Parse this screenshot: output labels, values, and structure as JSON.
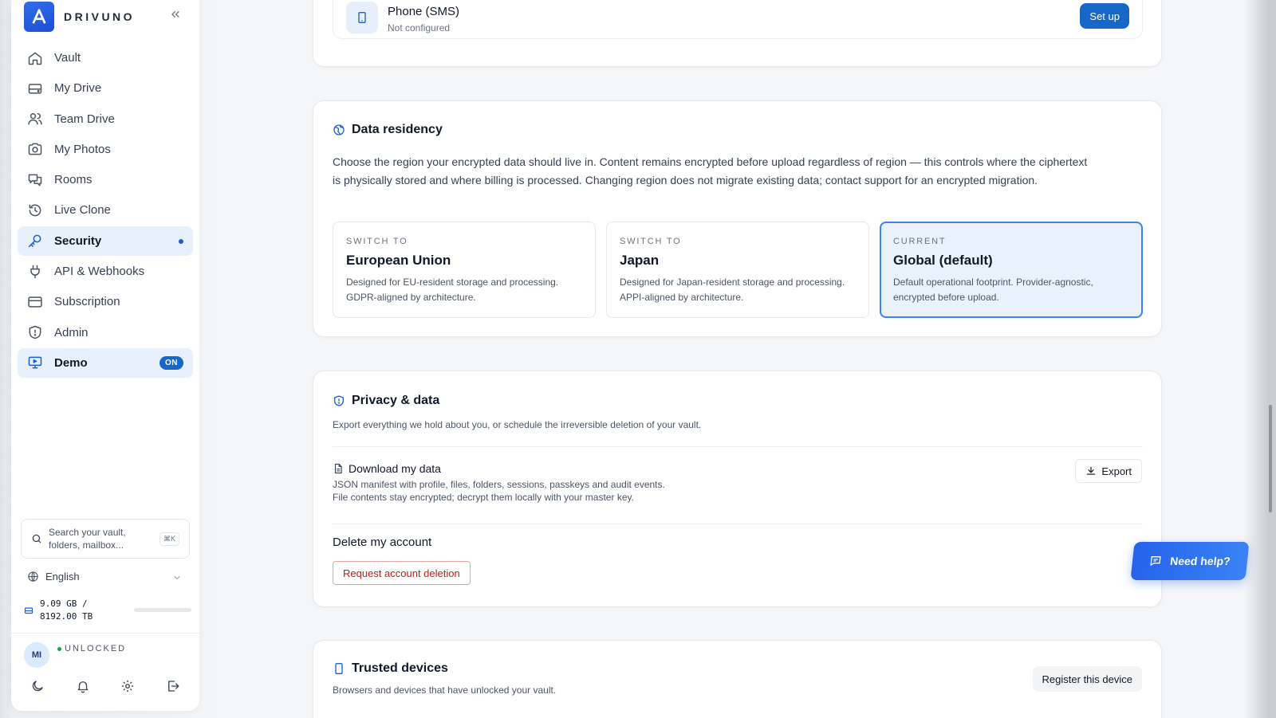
{
  "brand": {
    "name": "DRIVUNO"
  },
  "sidebar": {
    "items": [
      {
        "label": "Vault",
        "icon": "home-icon"
      },
      {
        "label": "My Drive",
        "icon": "drive-icon"
      },
      {
        "label": "Team Drive",
        "icon": "users-icon"
      },
      {
        "label": "My Photos",
        "icon": "camera-icon"
      },
      {
        "label": "Rooms",
        "icon": "chat-icon"
      },
      {
        "label": "Live Clone",
        "icon": "history-icon"
      },
      {
        "label": "Security",
        "icon": "key-icon",
        "active": true
      },
      {
        "label": "API & Webhooks",
        "icon": "plug-icon"
      },
      {
        "label": "Subscription",
        "icon": "card-icon"
      },
      {
        "label": "Admin",
        "icon": "shield-icon"
      },
      {
        "label": "Demo",
        "icon": "monitor-icon",
        "badge": "ON"
      }
    ],
    "search": {
      "placeholder": "Search your vault, folders, mailbox...",
      "shortcut": "⌘K"
    },
    "language": "English",
    "storage": {
      "used": "9.09 GB /",
      "total": "8192.00 TB",
      "fraction": 0.0
    },
    "user": {
      "initials": "MI",
      "status": "UNLOCKED"
    }
  },
  "colors": {
    "accent": "#1767c9",
    "active_bg": "#e8f1fb",
    "danger": "#b42318",
    "current_region_bg": "#e9f2fc"
  },
  "mfa": {
    "phone_title": "Phone (SMS)",
    "phone_status": "Not configured",
    "setup_label": "Set up"
  },
  "residency": {
    "title": "Data residency",
    "description": "Choose the region your encrypted data should live in. Content remains encrypted before upload regardless of region — this controls where the ciphertext is physically stored and where billing is processed. Changing region does not migrate existing data; contact support for an encrypted migration.",
    "regions": [
      {
        "kicker": "SWITCH TO",
        "name": "European Union",
        "desc": "Designed for EU-resident storage and processing. GDPR-aligned by architecture."
      },
      {
        "kicker": "SWITCH TO",
        "name": "Japan",
        "desc": "Designed for Japan-resident storage and processing. APPI-aligned by architecture."
      },
      {
        "kicker": "CURRENT",
        "name": "Global (default)",
        "desc": "Default operational footprint. Provider-agnostic, encrypted before upload."
      }
    ]
  },
  "privacy": {
    "title": "Privacy & data",
    "subtitle": "Export everything we hold about you, or schedule the irreversible deletion of your vault.",
    "download_title": "Download my data",
    "download_line1": "JSON manifest with profile, files, folders, sessions, passkeys and audit events.",
    "download_line2": "File contents stay encrypted; decrypt them locally with your master key.",
    "export_label": "Export",
    "delete_title": "Delete my account",
    "delete_button": "Request account deletion"
  },
  "devices": {
    "title": "Trusted devices",
    "subtitle": "Browsers and devices that have unlocked your vault.",
    "register_label": "Register this device"
  },
  "help": {
    "label": "Need help?"
  }
}
